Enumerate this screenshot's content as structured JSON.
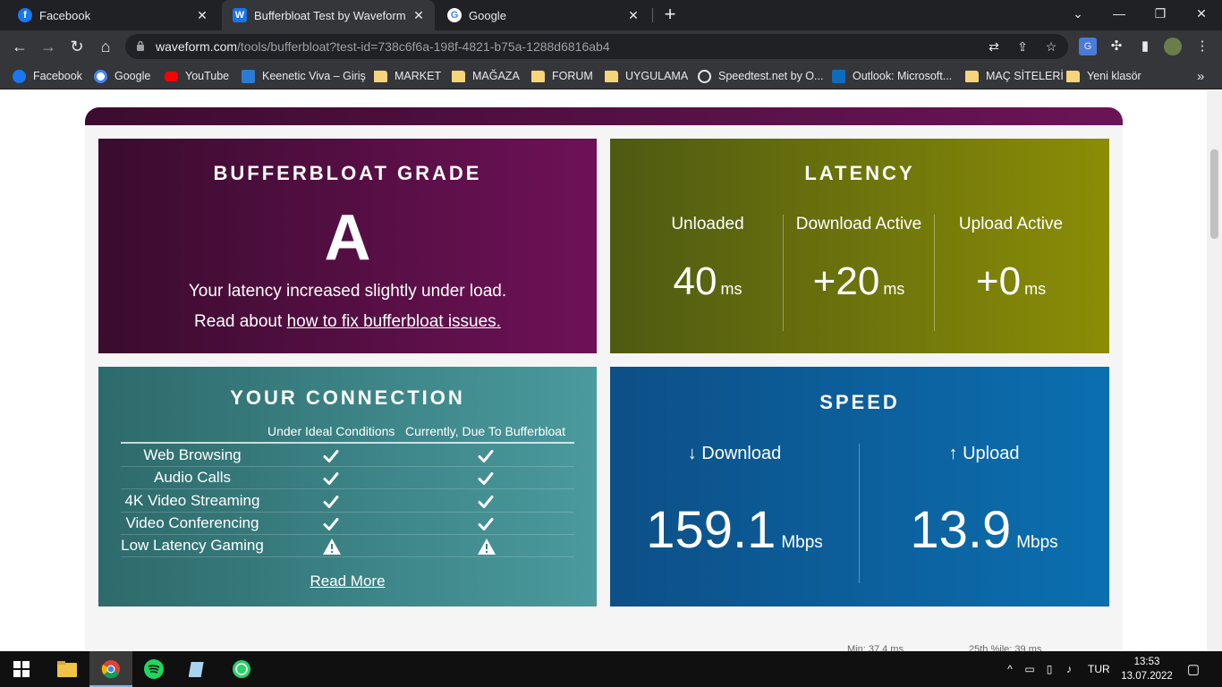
{
  "browser": {
    "tabs": [
      {
        "title": "Facebook",
        "icon": "facebook-icon",
        "active": false
      },
      {
        "title": "Bufferbloat Test by Waveform",
        "icon": "waveform-icon",
        "active": true
      },
      {
        "title": "Google",
        "icon": "google-icon",
        "active": false
      }
    ],
    "url_host": "waveform.com",
    "url_path": "/tools/bufferbloat?test-id=738c6f6a-198f-4821-b75a-1288d6816ab4",
    "bookmarks": [
      {
        "label": "Facebook",
        "icon": "facebook-icon"
      },
      {
        "label": "Google",
        "icon": "google-icon"
      },
      {
        "label": "YouTube",
        "icon": "youtube-icon"
      },
      {
        "label": "Keenetic Viva – Giriş",
        "icon": "keenetic-icon"
      },
      {
        "label": "MARKET",
        "icon": "folder-icon"
      },
      {
        "label": "MAĞAZA",
        "icon": "folder-icon"
      },
      {
        "label": "FORUM",
        "icon": "folder-icon"
      },
      {
        "label": "UYGULAMA",
        "icon": "folder-icon"
      },
      {
        "label": "Speedtest.net by O...",
        "icon": "speedtest-icon"
      },
      {
        "label": "Outlook: Microsoft...",
        "icon": "outlook-icon"
      },
      {
        "label": "MAÇ SİTELERİ",
        "icon": "folder-icon"
      },
      {
        "label": "Yeni klasör",
        "icon": "folder-icon"
      }
    ],
    "more_bookmarks": "»"
  },
  "grade": {
    "title": "BUFFERBLOAT GRADE",
    "letter": "A",
    "message": "Your latency increased slightly under load.",
    "read_prefix": "Read about ",
    "read_link": "how to fix bufferbloat issues."
  },
  "latency": {
    "title": "LATENCY",
    "unloaded_label": "Unloaded",
    "unloaded_value": "40",
    "download_label": "Download Active",
    "download_value": "+20",
    "upload_label": "Upload Active",
    "upload_value": "+0",
    "unit": "ms"
  },
  "connection": {
    "title": "YOUR CONNECTION",
    "col_ideal": "Under Ideal Conditions",
    "col_current": "Currently, Due To Bufferbloat",
    "rows": [
      {
        "name": "Web Browsing",
        "ideal": "check",
        "current": "check"
      },
      {
        "name": "Audio Calls",
        "ideal": "check",
        "current": "check"
      },
      {
        "name": "4K Video Streaming",
        "ideal": "check",
        "current": "check"
      },
      {
        "name": "Video Conferencing",
        "ideal": "check",
        "current": "check"
      },
      {
        "name": "Low Latency Gaming",
        "ideal": "warning",
        "current": "warning"
      }
    ],
    "read_more": "Read More"
  },
  "speed": {
    "title": "SPEED",
    "download_label": "↓ Download",
    "download_value": "159.1",
    "upload_label": "↑ Upload",
    "upload_value": "13.9",
    "unit": "Mbps"
  },
  "peek": {
    "min": "Min: 37.4 ms",
    "p25": "25th %ile: 39 ms"
  },
  "taskbar": {
    "lang": "TUR",
    "time": "13:53",
    "date": "13.07.2022"
  }
}
